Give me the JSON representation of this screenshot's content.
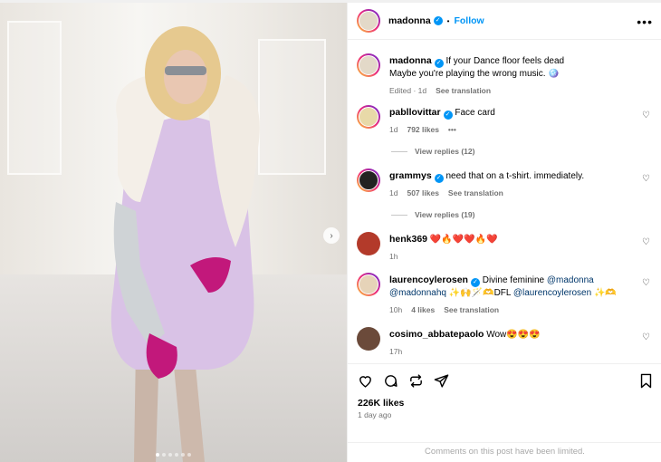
{
  "post": {
    "author": "madonna",
    "follow_label": "Follow",
    "separator": "•",
    "more_label": "•••",
    "caption_line1": "If your Dance floor feels dead",
    "caption_line2": "Maybe you're playing the wrong music. 🪩",
    "edited": "Edited · 1d",
    "see_translation": "See translation",
    "likes": "226K likes",
    "posted_ago": "1 day ago",
    "comments_limited": "Comments on this post have been limited.",
    "carousel": {
      "count": 6,
      "active": 0
    }
  },
  "comments": [
    {
      "user": "pabllovittar",
      "verified": true,
      "text": "Face card",
      "time": "1d",
      "likes": "792 likes",
      "extra": "•••",
      "replies": "View replies (12)"
    },
    {
      "user": "grammys",
      "verified": true,
      "text": "need that on a t-shirt. immediately.",
      "time": "1d",
      "likes": "507 likes",
      "extra": "See translation",
      "replies": "View replies (19)"
    },
    {
      "user": "henk369",
      "verified": false,
      "text": "❤️🔥❤️❤️🔥❤️",
      "time": "1h"
    },
    {
      "user": "laurencoylerosen",
      "verified": true,
      "text_pre": "Divine feminine ",
      "mention1": "@madonna",
      "mention2": "@madonnahq",
      "text_mid": " ✨🙌🪄🫶DFL ",
      "mention3": "@laurencoylerosen",
      "text_post": " ✨🫶",
      "time": "10h",
      "likes": "4 likes",
      "extra": "See translation"
    },
    {
      "user": "cosimo_abbatepaolo",
      "verified": false,
      "text": "Wow😍😍😍",
      "time": "17h"
    }
  ],
  "icons": {
    "heart": "♡",
    "comment": "comment-icon",
    "share": "share-icon",
    "bookmark": "bookmark-icon",
    "next": "›"
  },
  "colors": {
    "accent": "#0095f6",
    "mention": "#00376b",
    "muted": "#737373"
  }
}
